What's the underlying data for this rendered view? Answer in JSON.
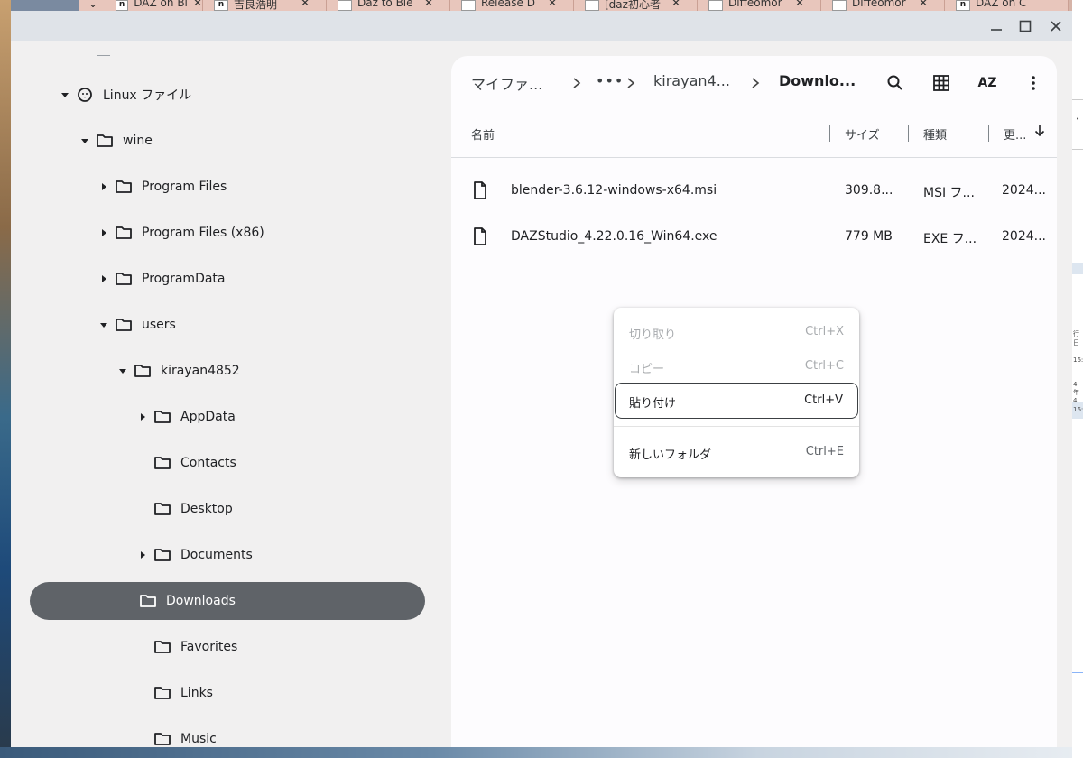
{
  "browser_tabs": [
    {
      "icon": "n",
      "title": "DAZ on Bl"
    },
    {
      "icon": "n",
      "title": "吉良浩明"
    },
    {
      "icon": "",
      "title": "Daz to Ble"
    },
    {
      "icon": "",
      "title": "Release D"
    },
    {
      "icon": "",
      "title": "[daz初心者"
    },
    {
      "icon": "",
      "title": "Diffeomor"
    },
    {
      "icon": "",
      "title": "Diffeomor"
    },
    {
      "icon": "n",
      "title": "DAZ on C"
    }
  ],
  "browser_chevron": "⌄",
  "window_controls": {
    "minimize": "—",
    "maximize": "☐",
    "close": "✕"
  },
  "sidebar": {
    "items": [
      {
        "label": "Linux ファイル",
        "expanded": true
      },
      {
        "label": "wine",
        "expanded": true
      },
      {
        "label": "Program Files",
        "expanded": false
      },
      {
        "label": "Program Files (x86)",
        "expanded": false
      },
      {
        "label": "ProgramData",
        "expanded": false
      },
      {
        "label": "users",
        "expanded": true
      },
      {
        "label": "kirayan4852",
        "expanded": true
      },
      {
        "label": "AppData",
        "expanded": false
      },
      {
        "label": "Contacts"
      },
      {
        "label": "Desktop"
      },
      {
        "label": "Documents",
        "expanded": false
      },
      {
        "label": "Downloads",
        "selected": true
      },
      {
        "label": "Favorites"
      },
      {
        "label": "Links"
      },
      {
        "label": "Music"
      }
    ]
  },
  "breadcrumb": {
    "items": [
      "マイファ...",
      "•••",
      "kirayan4...",
      "Downlo..."
    ],
    "separator": ">"
  },
  "toolbar": {
    "search_icon": "search-icon",
    "grid_icon": "grid-view-icon",
    "sort_icon": "sort-az-icon",
    "sort_label": "AZ",
    "more_icon": "more-vert-icon"
  },
  "file_table": {
    "columns": [
      "名前",
      "サイズ",
      "種類",
      "更..."
    ],
    "sort_indicator": "↓",
    "rows": [
      {
        "name": "blender-3.6.12-windows-x64.msi",
        "size": "309.8...",
        "type": "MSI フ...",
        "modified": "2024..."
      },
      {
        "name": "DAZStudio_4.22.0.16_Win64.exe",
        "size": "779 MB",
        "type": "EXE フ...",
        "modified": "2024..."
      }
    ]
  },
  "context_menu": {
    "items": [
      {
        "label": "切り取り",
        "shortcut": "Ctrl+X",
        "state": "disabled"
      },
      {
        "label": "コピー",
        "shortcut": "Ctrl+C",
        "state": "disabled"
      },
      {
        "label": "貼り付け",
        "shortcut": "Ctrl+V",
        "state": "highlighted"
      },
      {
        "label": "新しいフォルダ",
        "shortcut": "Ctrl+E",
        "state": "normal"
      }
    ]
  },
  "right_sliver": {
    "texts": [
      "•",
      "行日",
      "16:",
      "4年4",
      "16:"
    ]
  },
  "colors": {
    "selected_row": "#5f6368",
    "sidebar_bg": "#f1f0f0",
    "main_bg": "#fdfcfe",
    "titlebar": "#dfe3e8"
  }
}
